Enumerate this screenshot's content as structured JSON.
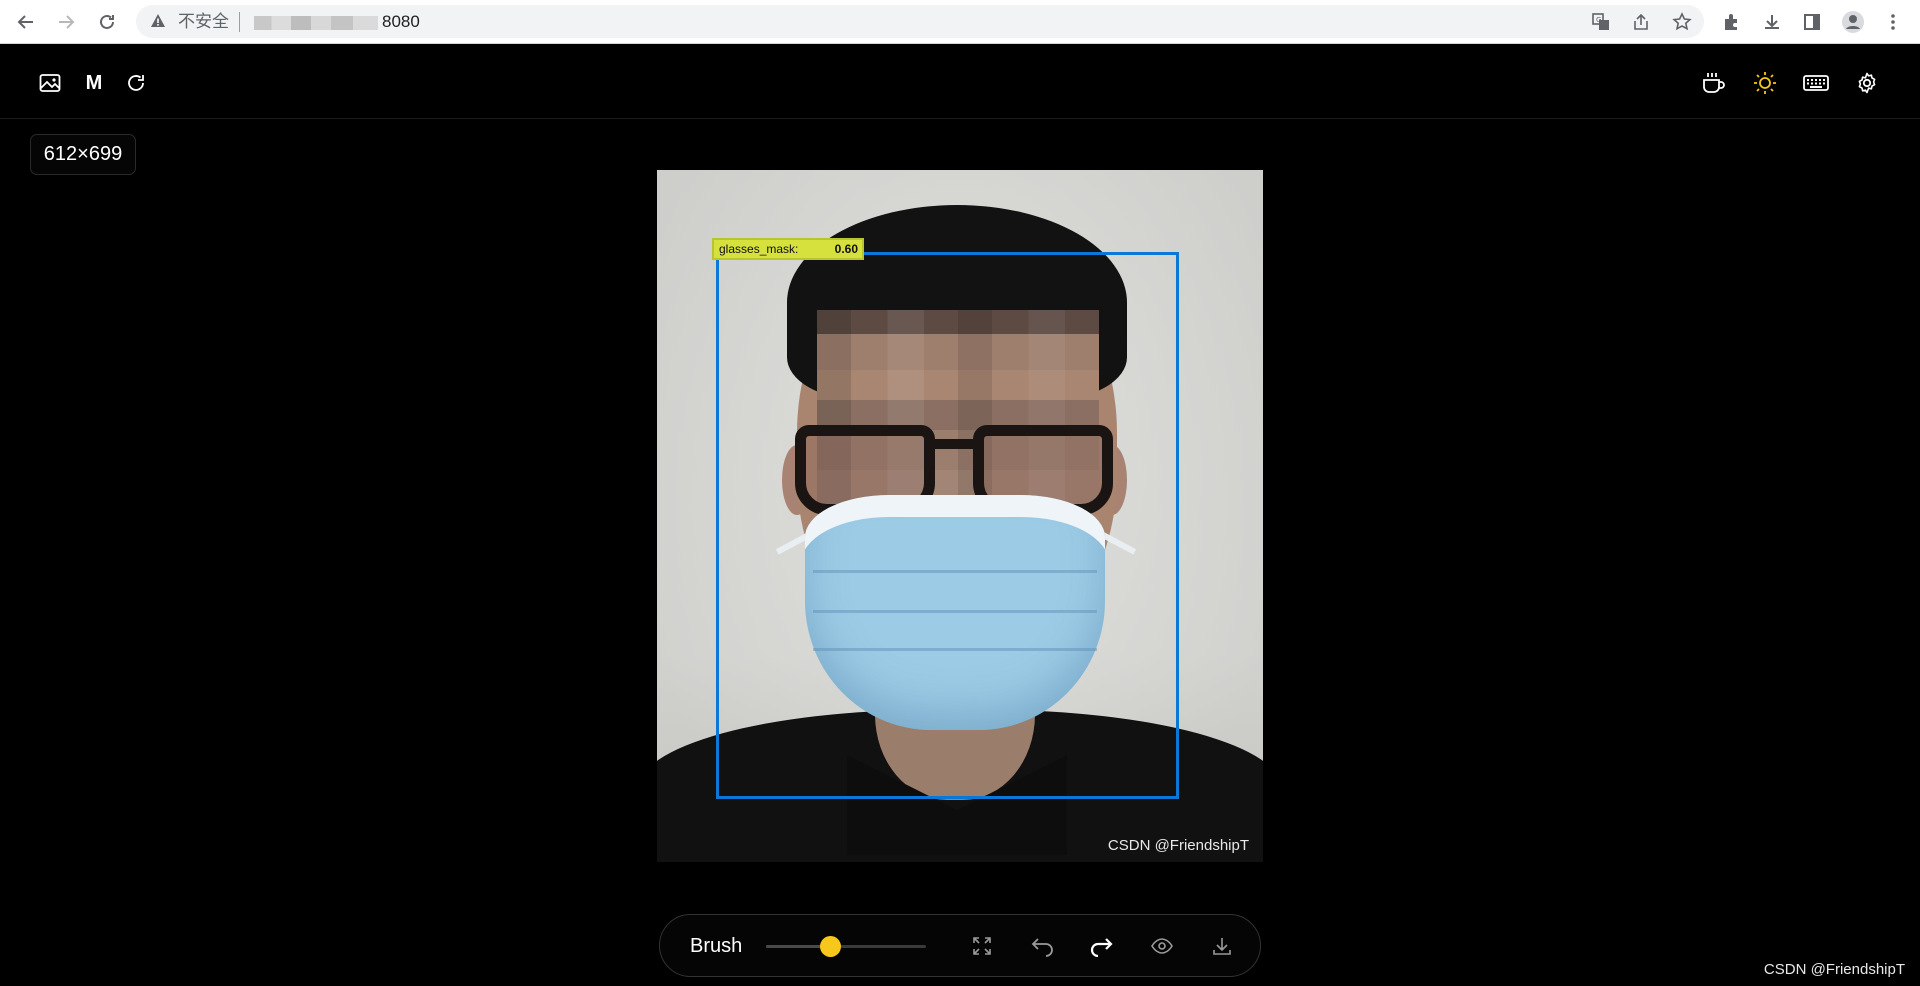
{
  "browser": {
    "security_label": "不安全",
    "url_suffix": "8080"
  },
  "canvas_info": {
    "image_size": "612×699"
  },
  "detection": {
    "label": "glasses_mask:",
    "score": "0.60"
  },
  "image_watermark": "CSDN @FriendshipT",
  "toolbar": {
    "tool_label": "Brush",
    "brush_size": 0.4
  },
  "page_watermark": "CSDN @FriendshipT",
  "colors": {
    "accent": "#f8c71c",
    "box": "#0a78d6",
    "label_bg": "#d6e13d"
  }
}
